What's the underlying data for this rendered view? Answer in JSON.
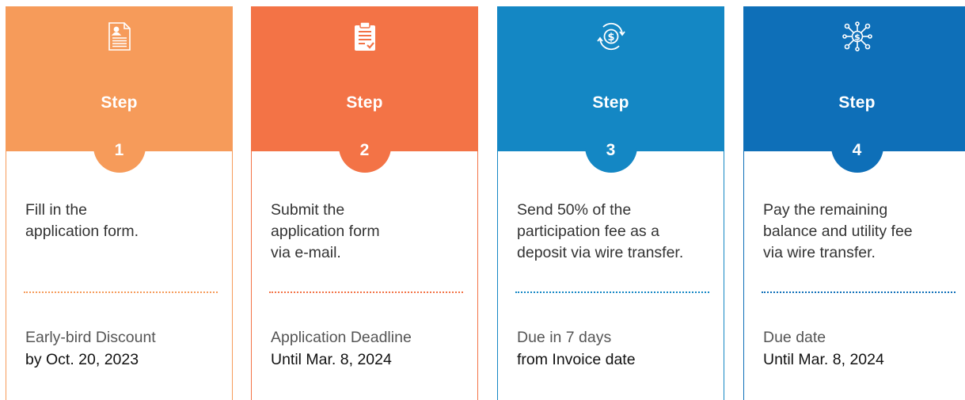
{
  "steps": [
    {
      "label": "Step",
      "number": "1",
      "color": "#F69B5A",
      "icon": "resume-document-icon",
      "desc": [
        "Fill in the",
        "application form."
      ],
      "due_line1": "Early-bird Discount",
      "due_line2": "by Oct. 20, 2023"
    },
    {
      "label": "Step",
      "number": "2",
      "color": "#F37346",
      "icon": "clipboard-check-icon",
      "desc": [
        "Submit the",
        "application form",
        "via e-mail."
      ],
      "due_line1": "Application Deadline",
      "due_line2": "Until Mar. 8, 2024"
    },
    {
      "label": "Step",
      "number": "3",
      "color": "#1487C4",
      "icon": "dollar-cycle-icon",
      "desc": [
        "Send 50% of the",
        "participation fee as a",
        "deposit via wire transfer."
      ],
      "due_line1": "Due in 7 days",
      "due_line2": "from Invoice date"
    },
    {
      "label": "Step",
      "number": "4",
      "color": "#0E6FB8",
      "icon": "dollar-network-icon",
      "desc": [
        "Pay the remaining",
        "balance and utility fee",
        "via wire transfer."
      ],
      "due_line1": "Due date",
      "due_line2": "Until Mar. 8, 2024"
    }
  ]
}
